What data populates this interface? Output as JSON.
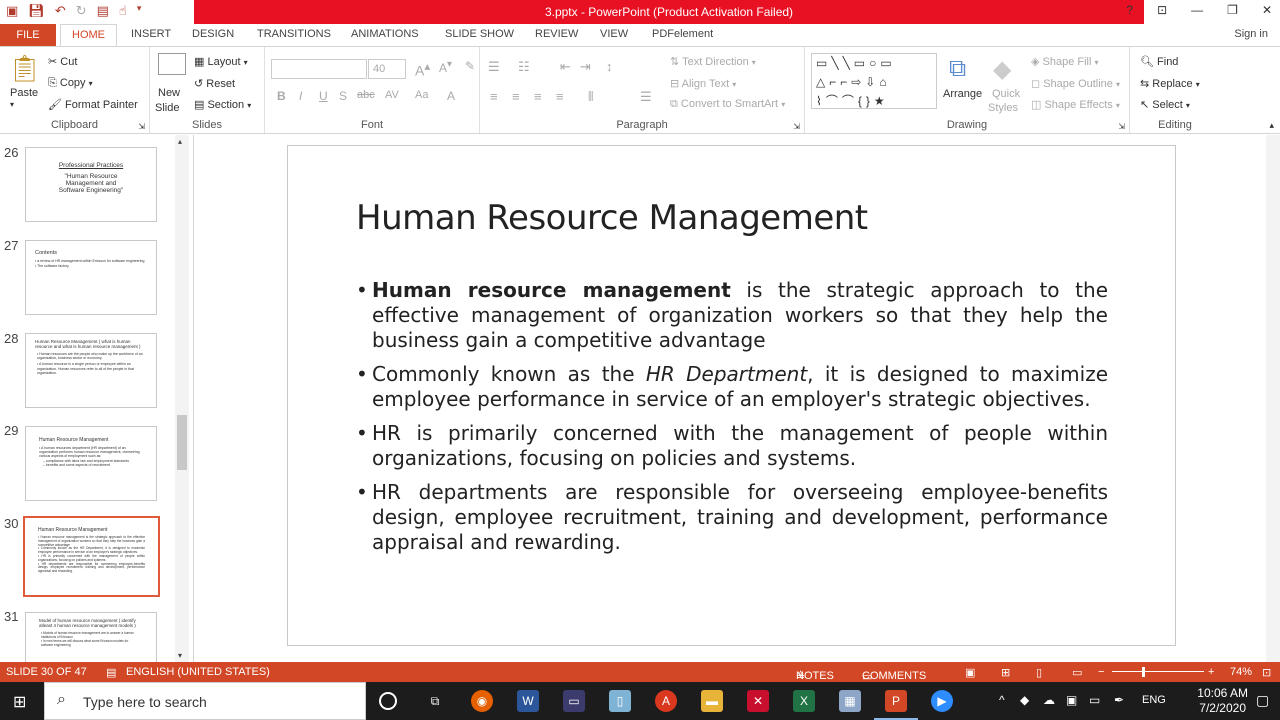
{
  "window": {
    "title": "3.pptx -  PowerPoint (Product Activation Failed)"
  },
  "tabs": [
    "FILE",
    "HOME",
    "INSERT",
    "DESIGN",
    "TRANSITIONS",
    "ANIMATIONS",
    "SLIDE SHOW",
    "REVIEW",
    "VIEW",
    "PDFelement"
  ],
  "signin": "Sign in",
  "ribbon": {
    "clipboard": {
      "paste": "Paste",
      "cut": "Cut",
      "copy": "Copy",
      "format_painter": "Format Painter",
      "label": "Clipboard"
    },
    "slides": {
      "new_slide_1": "New",
      "new_slide_2": "Slide",
      "layout": "Layout",
      "reset": "Reset",
      "section": "Section",
      "label": "Slides"
    },
    "font": {
      "size": "40",
      "label": "Font"
    },
    "paragraph": {
      "text_direction": "Text Direction",
      "align_text": "Align Text",
      "convert_smartart": "Convert to SmartArt",
      "label": "Paragraph"
    },
    "drawing": {
      "arrange": "Arrange",
      "quick_styles_1": "Quick",
      "quick_styles_2": "Styles",
      "shape_fill": "Shape Fill",
      "shape_outline": "Shape Outline",
      "shape_effects": "Shape Effects",
      "label": "Drawing"
    },
    "editing": {
      "find": "Find",
      "replace": "Replace",
      "select": "Select",
      "label": "Editing"
    }
  },
  "thumbnails": [
    {
      "num": "26",
      "lines": [
        "Professional Practices",
        "\"Human Resource Management and Software Engineering\""
      ]
    },
    {
      "num": "27",
      "lines": [
        "Contents",
        "• a review of HR management within Ericsson for software engineering",
        "• The software factory"
      ]
    },
    {
      "num": "28",
      "lines": [
        "Human Resource Management ( what is human resource and what is human resource management )",
        "• Human resources are the people who make up the workforce of an organization, business sector or economy.",
        "• A human resource is a single person or employee within an organization. Human resources refer to all of the people in that organization."
      ]
    },
    {
      "num": "29",
      "lines": [
        "Human Resource Management",
        "• A human resources department (HR department) of an organization performs human resource management, overseeing various aspects of employment such as:",
        "  – compliance with labor law and employment standards",
        "  – benefits and some aspects of recruitment"
      ]
    },
    {
      "num": "30",
      "lines": [
        "Human Resource Management",
        "• Human resource management is the strategic approach to the effective management of organization workers so that they help the business gain a competitive advantage",
        "• Commonly known as the HR Department, it is designed to maximize employee performance in service of an employer's strategic objectives.",
        "• HR is primarily concerned with the management of people within organizations, focusing on policies and systems.",
        "• HR departments are responsible for overseeing employee-benefits design, employee recruitment, training and development, performance appraisal and rewarding."
      ]
    },
    {
      "num": "31",
      "lines": [
        "Model of human resource management ( identify atleast 4 human resource management models )",
        "• Models of human resource management are to answer a human institutions of Ericsson",
        "• In next terms we will discuss what some Ericsson models for software engineering"
      ]
    }
  ],
  "slide": {
    "title": "Human Resource Management",
    "b1_bold": "Human resource management",
    "b1_rest": " is the strategic approach to the effective management of organization workers so that they help the business gain a competitive advantage",
    "b2_pre": "Commonly known as the ",
    "b2_italic": "HR Department",
    "b2_post": ", it is designed to maximize employee performance in service of an employer's strategic objectives.",
    "b3": "HR is primarily concerned with the management of people within organizations, focusing on policies and systems.",
    "b4": "HR departments are responsible for overseeing employee-benefits design, employee recruitment, training and development, performance appraisal and rewarding."
  },
  "status": {
    "slide_count": "SLIDE 30 OF 47",
    "language": "ENGLISH (UNITED STATES)",
    "notes": "NOTES",
    "comments": "COMMENTS",
    "zoom": "74%"
  },
  "taskbar": {
    "search_placeholder": "Type here to search",
    "lang": "ENG",
    "time": "10:06 AM",
    "date": "7/2/2020"
  },
  "colors": {
    "accent": "#d24726",
    "titlebar_red": "#e81123",
    "taskbar": "#1c1c1c"
  }
}
